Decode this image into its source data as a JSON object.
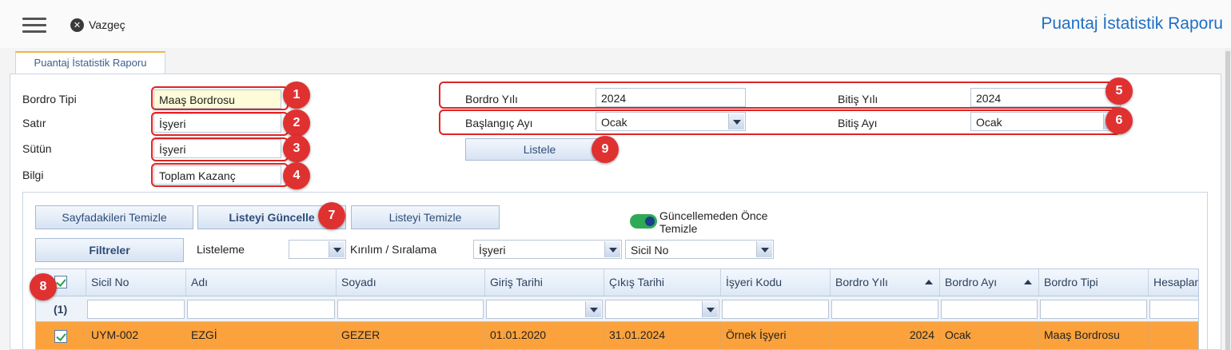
{
  "header": {
    "cancel_label": "Vazgeç",
    "title": "Puantaj İstatistik Raporu"
  },
  "tab": {
    "label": "Puantaj İstatistik Raporu"
  },
  "form": {
    "bordro_tipi": {
      "label": "Bordro Tipi",
      "value": "Maaş Bordrosu"
    },
    "satir": {
      "label": "Satır",
      "value": "İşyeri"
    },
    "sutun": {
      "label": "Sütün",
      "value": "İşyeri"
    },
    "bilgi": {
      "label": "Bilgi",
      "value": "Toplam Kazanç"
    },
    "bordro_yili": {
      "label": "Bordro Yılı",
      "value": "2024"
    },
    "bitis_yili": {
      "label": "Bitiş Yılı",
      "value": "2024"
    },
    "baslangic_ayi": {
      "label": "Başlangıç Ayı",
      "value": "Ocak"
    },
    "bitis_ayi": {
      "label": "Bitiş Ayı",
      "value": "Ocak"
    },
    "listele_label": "Listele"
  },
  "badges": [
    "1",
    "2",
    "3",
    "4",
    "5",
    "6",
    "7",
    "8",
    "9"
  ],
  "toolbar": {
    "clear_page_label": "Sayfadakileri Temizle",
    "update_list_label": "Listeyi Güncelle",
    "clear_list_label": "Listeyi Temizle",
    "toggle_label": "Güncellemeden Önce Temizle",
    "filters_label": "Filtreler",
    "listeleme_label": "Listeleme",
    "listeleme_value": "",
    "kirilim_label": "Kırılım / Sıralama",
    "kirilim_value1": "İşyeri",
    "kirilim_value2": "Sicil No"
  },
  "grid": {
    "columns": [
      "Sicil No",
      "Adı",
      "Soyadı",
      "Giriş Tarihi",
      "Çıkış Tarihi",
      "İşyeri Kodu",
      "Bordro Yılı",
      "Bordro Ayı",
      "Bordro Tipi",
      "Hesaplan"
    ],
    "filter_count": "(1)",
    "rows": [
      {
        "sicil_no": "UYM-002",
        "adi": "EZGİ",
        "soyadi": "GEZER",
        "giris": "01.01.2020",
        "cikis": "31.01.2024",
        "isyeri_kodu": "Örnek İşyeri",
        "bordro_yili": "2024",
        "bordro_ayi": "Ocak",
        "bordro_tipi": "Maaş Bordrosu"
      }
    ]
  },
  "colors": {
    "accent": "#1f6fc5",
    "annotation_red": "#e03131",
    "row_highlight": "#fba23c",
    "toggle_green": "#2eaa57"
  }
}
